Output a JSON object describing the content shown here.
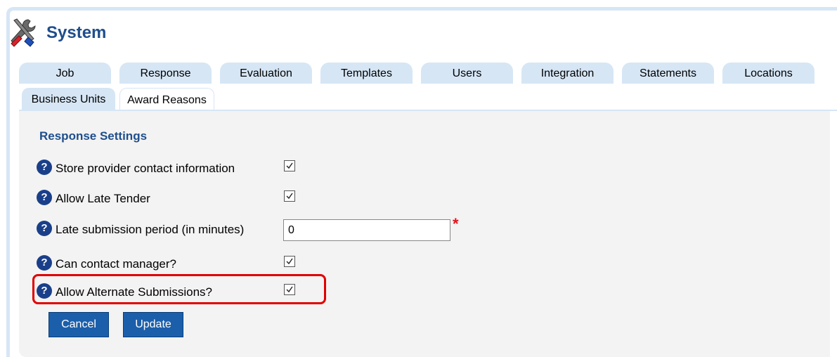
{
  "header": {
    "title": "System",
    "icon": "tools-icon"
  },
  "tabs_row1": [
    {
      "label": "Job"
    },
    {
      "label": "Response"
    },
    {
      "label": "Evaluation"
    },
    {
      "label": "Templates"
    },
    {
      "label": "Users"
    },
    {
      "label": "Integration"
    },
    {
      "label": "Statements"
    },
    {
      "label": "Locations"
    }
  ],
  "tabs_row2": [
    {
      "label": "Business Units"
    },
    {
      "label": "Award Reasons"
    }
  ],
  "section": {
    "title": "Response Settings"
  },
  "settings": [
    {
      "label": "Store provider contact information",
      "type": "checkbox",
      "checked": true
    },
    {
      "label": "Allow Late Tender",
      "type": "checkbox",
      "checked": true
    },
    {
      "label": "Late submission period (in minutes)",
      "type": "text",
      "value": "0",
      "required_marker": "*"
    },
    {
      "label": "Can contact manager?",
      "type": "checkbox",
      "checked": true
    },
    {
      "label": "Allow Alternate Submissions?",
      "type": "checkbox",
      "checked": true
    }
  ],
  "help_glyph": "?",
  "buttons": {
    "cancel": "Cancel",
    "update": "Update"
  },
  "colors": {
    "accent_blue": "#1f4e8c",
    "tab_bg": "#d6e6f5",
    "button_bg": "#1b5fab",
    "highlight_red": "#e00000",
    "required_red": "#e0131d"
  }
}
